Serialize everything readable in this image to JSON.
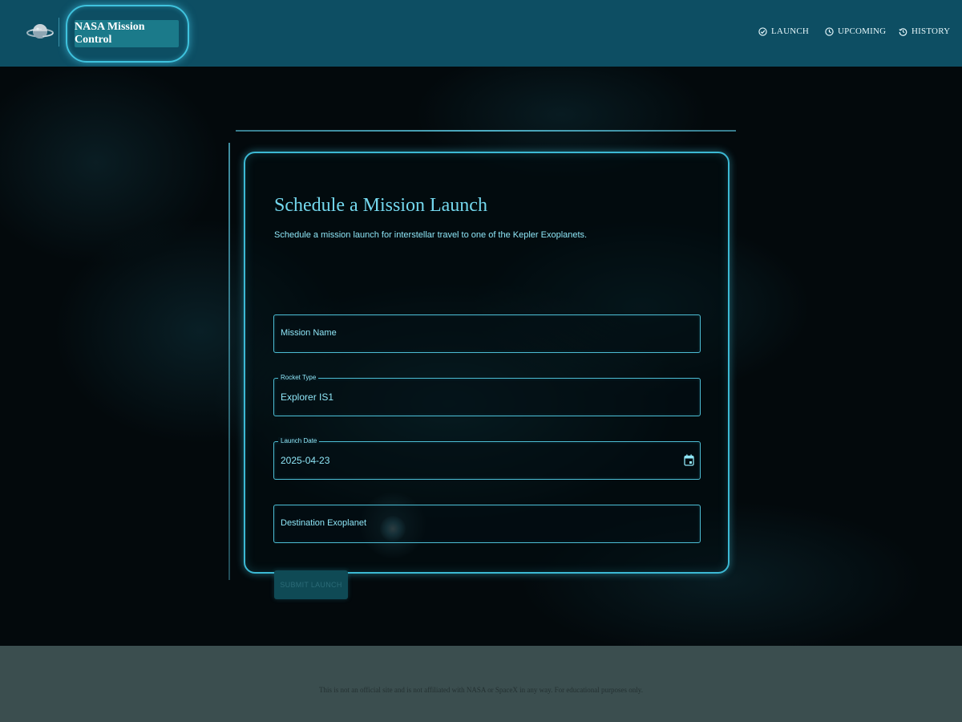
{
  "header": {
    "brand": "NASA Mission Control",
    "nav": [
      {
        "label": "LAUNCH",
        "icon": "check-circle-icon"
      },
      {
        "label": "UPCOMING",
        "icon": "clock-icon"
      },
      {
        "label": "HISTORY",
        "icon": "history-icon"
      }
    ]
  },
  "form": {
    "title": "Schedule a Mission Launch",
    "description": "Schedule a mission launch for interstellar travel to one of the Kepler Exoplanets.",
    "mission_name": {
      "placeholder": "Mission Name",
      "value": ""
    },
    "rocket_type": {
      "label": "Rocket Type",
      "value": "Explorer IS1"
    },
    "launch_date": {
      "label": "Launch Date",
      "value": "2025-04-23"
    },
    "destination": {
      "placeholder": "Destination Exoplanet",
      "value": ""
    },
    "submit_label": "SUBMIT LAUNCH"
  },
  "footer": {
    "disclaimer": "This is not an official site and is not affiliated with NASA or SpaceX in any way. For educational purposes only."
  },
  "colors": {
    "header_bg": "#0d4e63",
    "accent": "#3cb9d4",
    "text": "#8fe6f7",
    "footer_bg": "#3b4e4f"
  }
}
